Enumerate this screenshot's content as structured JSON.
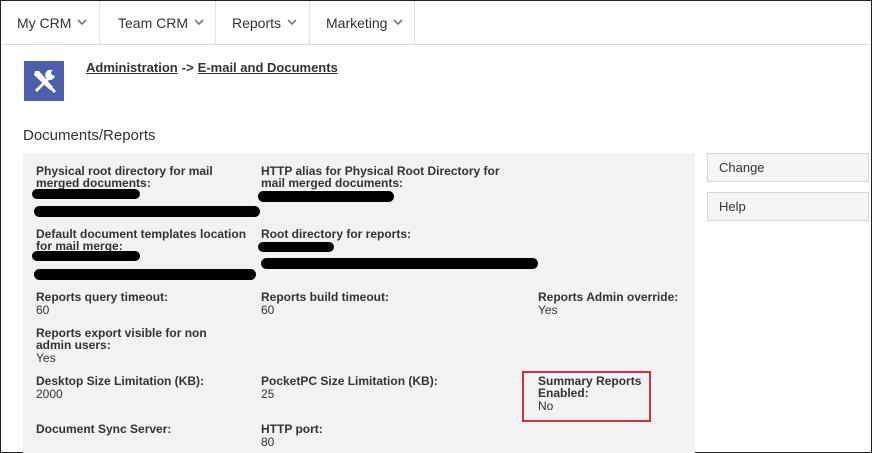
{
  "nav": {
    "items": [
      {
        "label": "My CRM"
      },
      {
        "label": "Team CRM"
      },
      {
        "label": "Reports"
      },
      {
        "label": "Marketing"
      }
    ]
  },
  "header": {
    "icon": "tools-icon",
    "breadcrumb": {
      "root": "Administration",
      "separator": "->",
      "current": "E-mail and Documents"
    }
  },
  "section": {
    "title": "Documents/Reports"
  },
  "fields": {
    "physical_root": {
      "label": "Physical root directory for mail merged documents:"
    },
    "http_alias": {
      "label": "HTTP alias for Physical Root Directory for mail merged documents:"
    },
    "templates_location": {
      "label": "Default document templates location for mail merge:"
    },
    "root_reports": {
      "label": "Root directory for reports:"
    },
    "query_timeout": {
      "label": "Reports query timeout:",
      "value": "60"
    },
    "build_timeout": {
      "label": "Reports build timeout:",
      "value": "60"
    },
    "admin_override": {
      "label": "Reports Admin override:",
      "value": "Yes"
    },
    "export_visible": {
      "label": "Reports export visible for non admin users:",
      "value": "Yes"
    },
    "desktop_limit": {
      "label": "Desktop Size Limitation (KB):",
      "value": "2000"
    },
    "pocketpc_limit": {
      "label": "PocketPC Size Limitation (KB):",
      "value": "25"
    },
    "summary_reports": {
      "label": "Summary Reports Enabled:",
      "value": "No"
    },
    "sync_server": {
      "label": "Document Sync Server:"
    },
    "http_port": {
      "label": "HTTP port:",
      "value": "80"
    }
  },
  "actions": {
    "change_label": "Change",
    "help_label": "Help"
  },
  "colors": {
    "icon_bg": "#4b5fad",
    "highlight": "#d0303a",
    "panel_bg": "#f2f2f2"
  }
}
